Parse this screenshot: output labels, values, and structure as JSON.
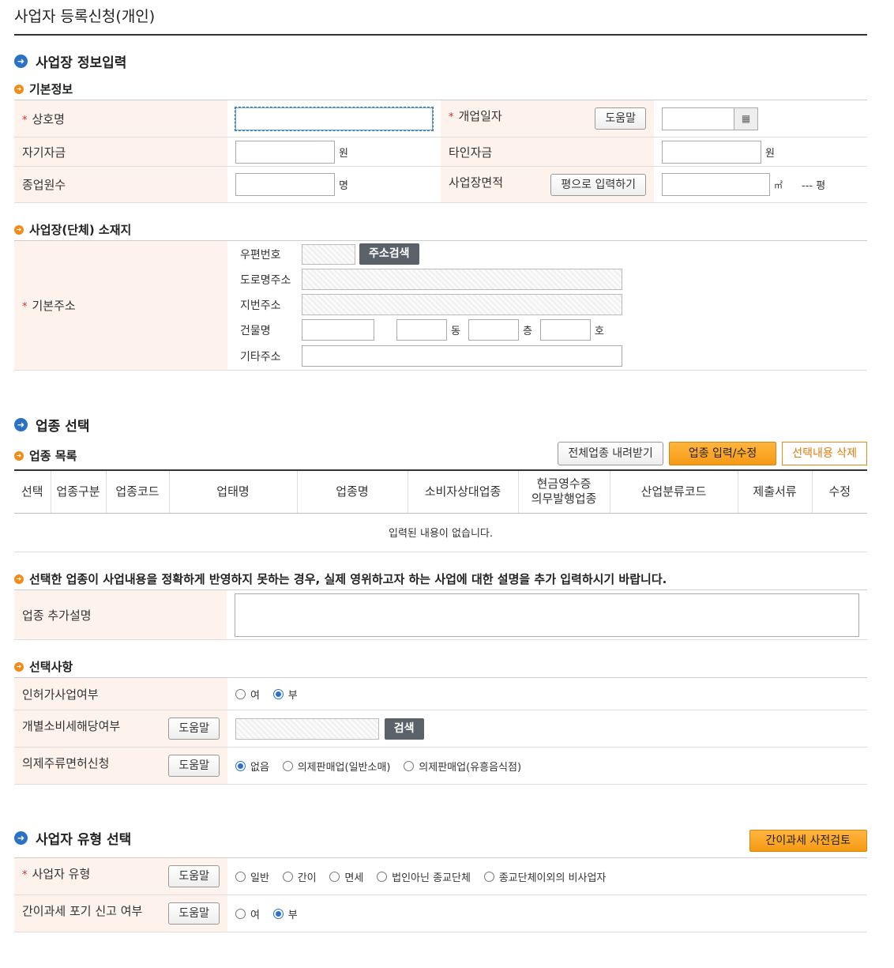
{
  "page_title": "사업자 등록신청(개인)",
  "sections": {
    "business_info": "사업장 정보입력",
    "industry": "업종 선택",
    "type": "사업자 유형 선택"
  },
  "basic": {
    "heading": "기본정보",
    "trade_name": "상호명",
    "open_date": "개업일자",
    "help": "도움말",
    "own_capital": "자기자금",
    "won": "원",
    "other_capital": "타인자금",
    "employees": "종업원수",
    "persons": "명",
    "area": "사업장면적",
    "pyeong_btn": "평으로 입력하기",
    "sqm": "㎡",
    "pyeong_val": "--- 평"
  },
  "address": {
    "heading": "사업장(단체) 소재지",
    "base_label": "기본주소",
    "zip": "우편번호",
    "search_btn": "주소검색",
    "road": "도로명주소",
    "lot": "지번주소",
    "building": "건물명",
    "dong": "동",
    "floor": "층",
    "ho": "호",
    "etc": "기타주소"
  },
  "industry": {
    "list_heading": "업종 목록",
    "btn_download": "전체업종 내려받기",
    "btn_edit": "업종 입력/수정",
    "btn_delete": "선택내용 삭제",
    "columns": [
      "선택",
      "업종구분",
      "업종코드",
      "업태명",
      "업종명",
      "소비자상대업종",
      "현금영수증\n의무발행업종",
      "산업분류코드",
      "제출서류",
      "수정"
    ],
    "empty": "입력된 내용이 없습니다.",
    "note": "선택한 업종이 사업내용을 정확하게 반영하지 못하는 경우, 실제 영위하고자 하는 사업에 대한 설명을 추가 입력하시기 바랍니다.",
    "extra_label": "업종 추가설명"
  },
  "options": {
    "heading": "선택사항",
    "license_label": "인허가사업여부",
    "yes": "여",
    "no": "부",
    "excise_label": "개별소비세해당여부",
    "search": "검색",
    "liquor_label": "의제주류면허신청",
    "liquor_none": "없음",
    "liquor_retail": "의제판매업(일반소매)",
    "liquor_entertain": "의제판매업(유흥음식점)"
  },
  "type": {
    "precheck_btn": "간이과세 사전검토",
    "type_label": "사업자 유형",
    "general": "일반",
    "simplified": "간이",
    "exempt": "면세",
    "religious": "법인아닌 종교단체",
    "nonbiz": "종교단체이외의 비사업자",
    "waiver_label": "간이과세 포기 신고 여부"
  }
}
